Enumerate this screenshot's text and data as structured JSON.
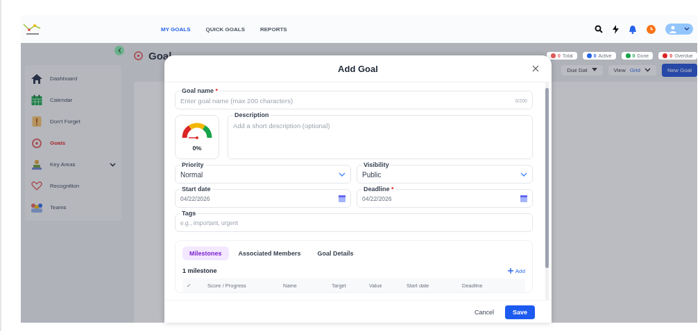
{
  "header": {
    "nav": [
      {
        "label": "MY GOALS",
        "selected": true
      },
      {
        "label": "QUICK GOALS",
        "selected": false
      },
      {
        "label": "REPORTS",
        "selected": false
      }
    ]
  },
  "sidebar": {
    "items": [
      {
        "label": "Dashboard",
        "kind": "home",
        "selected": false
      },
      {
        "label": "Calendar",
        "kind": "calendar",
        "selected": false
      },
      {
        "label": "Don't Forget",
        "kind": "note",
        "selected": false
      },
      {
        "label": "Goals",
        "kind": "target",
        "selected": true
      },
      {
        "label": "Key Areas",
        "kind": "person",
        "selected": false,
        "expandable": true
      },
      {
        "label": "Recognition",
        "kind": "heart",
        "selected": false
      },
      {
        "label": "Teams",
        "kind": "team",
        "selected": false
      }
    ]
  },
  "page": {
    "title": "Goal",
    "stats": [
      {
        "count": "0",
        "label": "Total",
        "color": "#e05a5a"
      },
      {
        "count": "0",
        "label": "Active",
        "color": "#2563eb"
      },
      {
        "count": "0",
        "label": "Done",
        "color": "#16a34a"
      },
      {
        "count": "0",
        "label": "Overdue",
        "color": "#dc2626"
      }
    ],
    "sort": "Due Dat",
    "view_label": "View",
    "view": "Grid",
    "new_button": "New Goal"
  },
  "modal": {
    "title": "Add Goal",
    "goal_name": {
      "label": "Goal name",
      "required_mark": "*",
      "placeholder": "Enter goal name (max 200 characters)",
      "counter": "0/200"
    },
    "progress": {
      "reading": "0%"
    },
    "description": {
      "label": "Description",
      "placeholder": "Add a short description (optional)"
    },
    "priority": {
      "label": "Priority",
      "value": "Normal"
    },
    "visibility": {
      "label": "Visibility",
      "value": "Public"
    },
    "start_date": {
      "label": "Start date",
      "value": "04/22/2026"
    },
    "deadline": {
      "label": "Deadline",
      "required_mark": "*",
      "value": "04/22/2026"
    },
    "tags": {
      "label": "Tags",
      "placeholder": "e.g., important, urgent"
    },
    "tabs": [
      {
        "label": "Milestones",
        "selected": true
      },
      {
        "label": "Associated Members",
        "selected": false
      },
      {
        "label": "Goal Details",
        "selected": false
      }
    ],
    "milestone_count": "1 milestone",
    "add_label": "Add",
    "columns": [
      "✓",
      "Score / Progress",
      "Name",
      "Target",
      "Value",
      "Start date",
      "Deadline"
    ],
    "buttons": {
      "cancel": "Cancel",
      "save": "Save"
    }
  }
}
